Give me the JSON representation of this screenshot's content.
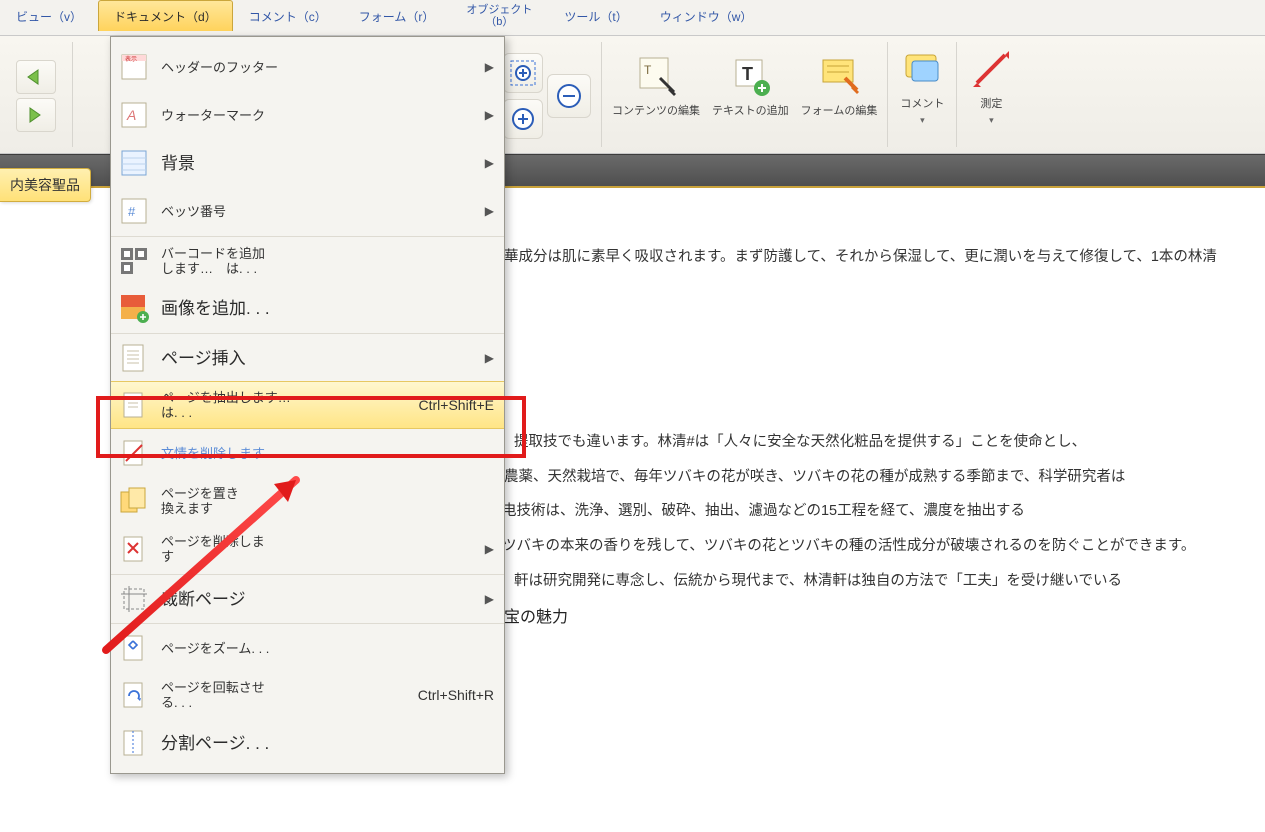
{
  "menubar": {
    "view": "ビュー（v）",
    "document": "ドキュメント（d）",
    "comment": "コメント（c）",
    "form": "フォーム（r）",
    "object_l1": "オブジェクト",
    "object_l2": "（b）",
    "tool": "ツール（t）",
    "window": "ウィンドウ（w）"
  },
  "ribbon": {
    "edit_content": "コンテンツの編集",
    "add_text": "テキストの追加",
    "edit_form": "フォームの編集",
    "comment": "コメント",
    "measure": "測定"
  },
  "tag": "内美容聖品",
  "doc_lines": {
    "l1": "華成分は肌に素早く吸収されます。まず防護して、それから保湿して、更に潤いを与えて修復して、1本の林清",
    "l2": "提取技でも違います。林清#は「人々に安全な天然化粧品を提供する」ことを使命とし、",
    "l3": "農薬、天然栽培で、毎年ツバキの花が咲き、ツバキの花の種が成熟する季節まで、科学研究者は",
    "l4": "电技術は、洗浄、選別、破砕、抽出、濾過などの15工程を経て、濃度を抽出する",
    "l5": "ツバキの本来の香りを残して、ツバキの花とツバキの種の活性成分が破壊されるのを防ぐことができます。",
    "l6": "軒は研究開発に専念し、伝統から現代まで、林清軒は独自の方法で「工夫」を受け継いでいる",
    "l7": "宝の魅力"
  },
  "dd": {
    "header_footer": "ヘッダーのフッター",
    "watermark": "ウォーターマーク",
    "background": "背景",
    "bates": "ベッツ番号",
    "barcode_l1": "バーコードを追加",
    "barcode_l2": "します…　は. . .",
    "add_image": "画像を追加. . .",
    "insert_page": "ページ挿入",
    "extract_l1": "ページを抽出します…",
    "extract_l2": "は. . .",
    "extract_shortcut": "Ctrl+Shift+E",
    "delete_text": "文情を削除します.",
    "replace_l1": "ページを置き",
    "replace_l2": "換えます",
    "delete_page_l1": "ページを削除しま",
    "delete_page_l2": "す",
    "crop_page": "裁断ページ",
    "zoom_page": "ページをズーム. . .",
    "rotate_l1": "ページを回転させ",
    "rotate_l2": "る. . .",
    "rotate_shortcut": "Ctrl+Shift+R",
    "split_page": "分割ページ. . ."
  }
}
